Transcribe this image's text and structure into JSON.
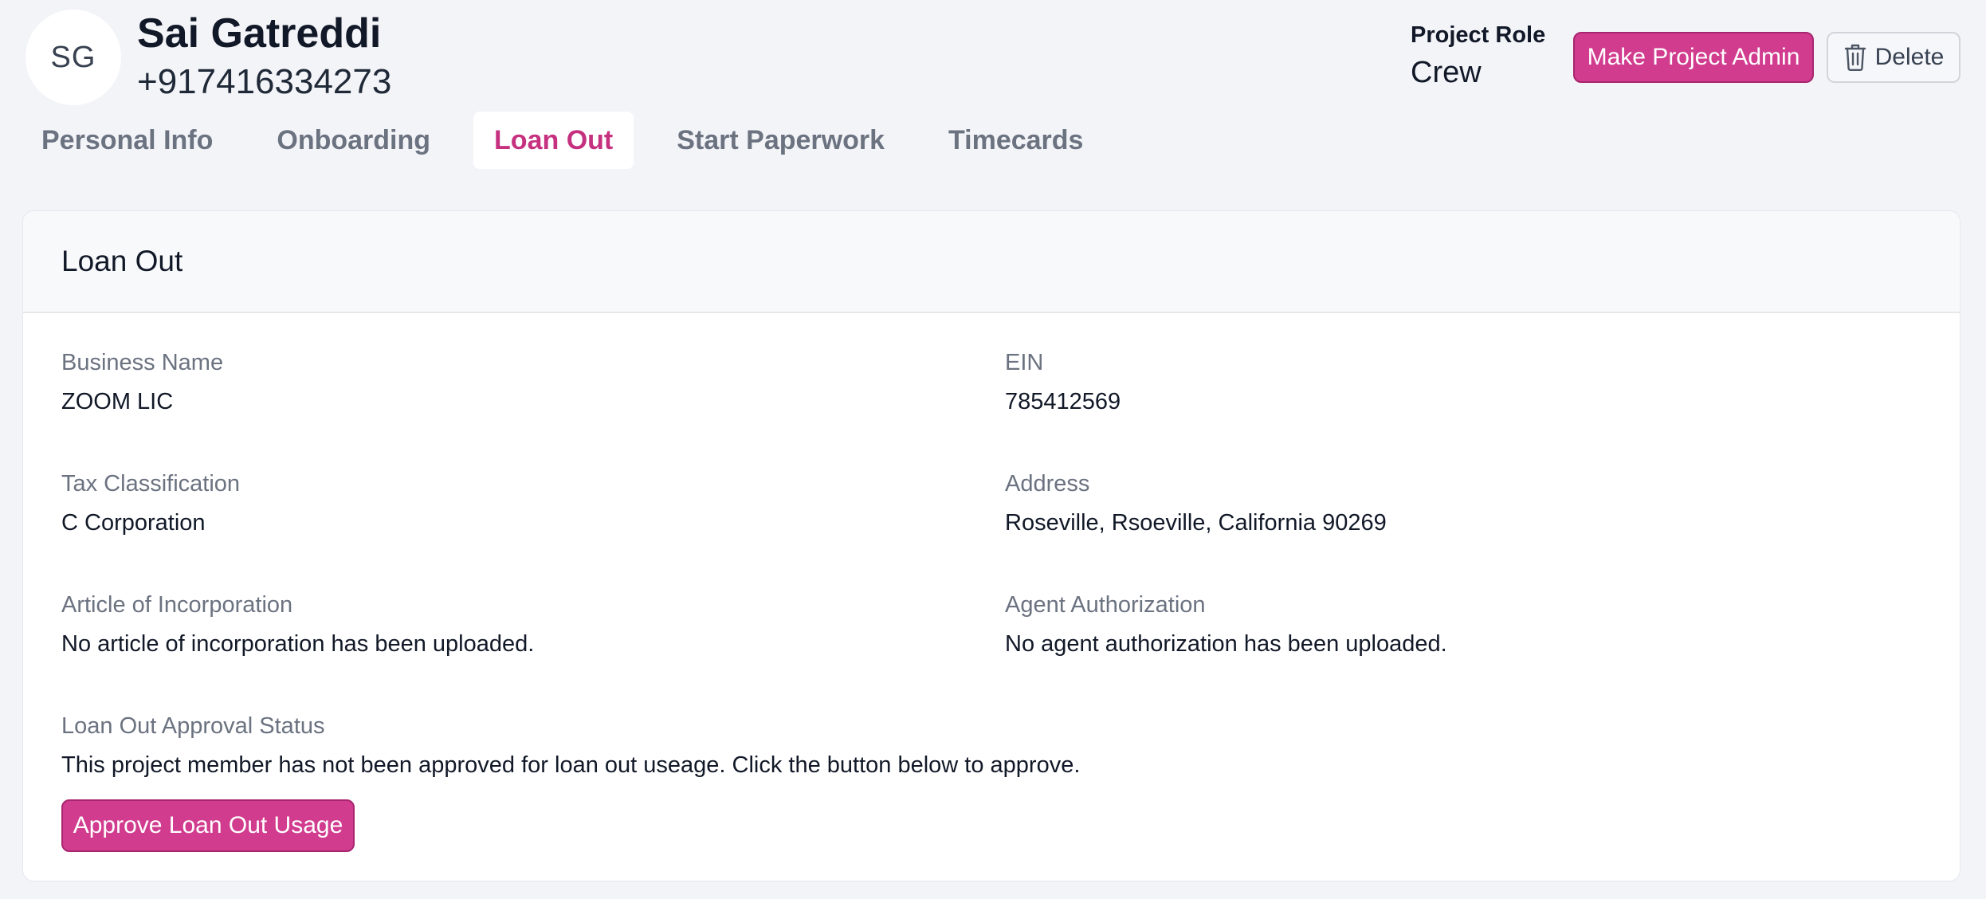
{
  "user": {
    "initials": "SG",
    "name": "Sai Gatreddi",
    "phone": "+917416334273"
  },
  "role": {
    "label": "Project Role",
    "value": "Crew"
  },
  "actions": {
    "make_admin_label": "Make Project Admin",
    "delete_label": "Delete"
  },
  "tabs": [
    {
      "label": "Personal Info",
      "active": false
    },
    {
      "label": "Onboarding",
      "active": false
    },
    {
      "label": "Loan Out",
      "active": true
    },
    {
      "label": "Start Paperwork",
      "active": false
    },
    {
      "label": "Timecards",
      "active": false
    }
  ],
  "card": {
    "title": "Loan Out",
    "fields": {
      "business_name": {
        "label": "Business Name",
        "value": "ZOOM LIC"
      },
      "ein": {
        "label": "EIN",
        "value": "785412569"
      },
      "tax_classification": {
        "label": "Tax Classification",
        "value": "C Corporation"
      },
      "address": {
        "label": "Address",
        "value": "Roseville, Rsoeville, California 90269"
      },
      "article": {
        "label": "Article of Incorporation",
        "value": "No article of incorporation has been uploaded."
      },
      "agent": {
        "label": "Agent Authorization",
        "value": "No agent authorization has been uploaded."
      },
      "approval": {
        "label": "Loan Out Approval Status",
        "value": "This project member has not been approved for loan out useage. Click the button below to approve."
      }
    },
    "approve_label": "Approve Loan Out Usage"
  },
  "colors": {
    "accent": "#d13c8f",
    "active_tab": "#c5317f",
    "background": "#f3f4f8"
  },
  "icons": {
    "delete": "trash-icon"
  }
}
